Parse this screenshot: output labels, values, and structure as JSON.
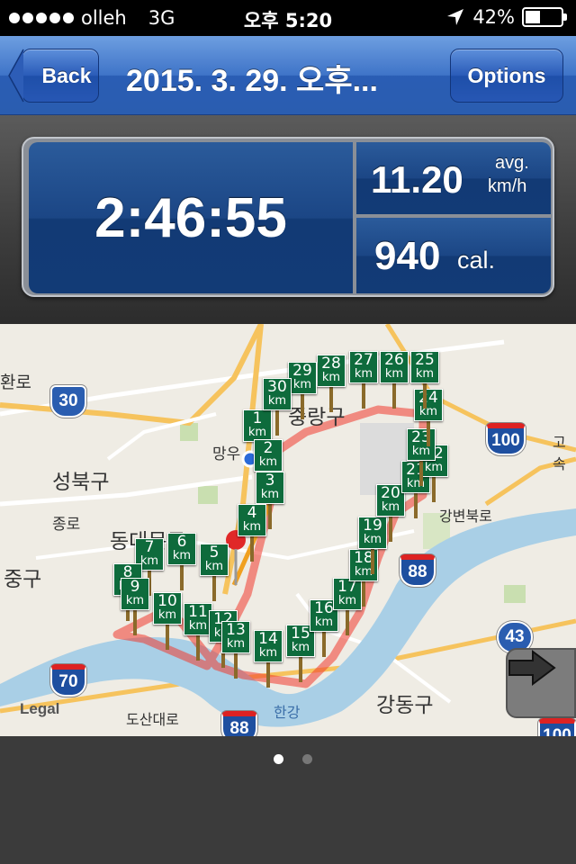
{
  "status_bar": {
    "carrier": "olleh",
    "network": "3G",
    "time": "오후 5:20",
    "battery": "42%",
    "battery_level": 0.42
  },
  "nav": {
    "back_label": "Back",
    "title": "2015. 3. 29. 오후...",
    "options_label": "Options"
  },
  "stats": {
    "duration": "2:46:55",
    "speed_value": "11.20",
    "speed_unit_line1": "avg.",
    "speed_unit_line2": "km/h",
    "calories_value": "940",
    "calories_unit": "cal."
  },
  "map": {
    "legal": "Legal",
    "labels": [
      "환로",
      "성북구",
      "종로",
      "동대문구",
      "중구",
      "망우",
      "중랑구",
      "강변북로",
      "강동구",
      "도산대로",
      "한강",
      "고속"
    ],
    "road_shields": [
      "30",
      "100",
      "88",
      "43",
      "70",
      "88",
      "100"
    ],
    "markers": [
      {
        "n": "1",
        "u": "km"
      },
      {
        "n": "2",
        "u": "km"
      },
      {
        "n": "3",
        "u": "km"
      },
      {
        "n": "4",
        "u": "km"
      },
      {
        "n": "5",
        "u": "km"
      },
      {
        "n": "6",
        "u": "km"
      },
      {
        "n": "7",
        "u": "km"
      },
      {
        "n": "8",
        "u": "km"
      },
      {
        "n": "9",
        "u": "km"
      },
      {
        "n": "10",
        "u": "km"
      },
      {
        "n": "11",
        "u": "km"
      },
      {
        "n": "12",
        "u": "km"
      },
      {
        "n": "13",
        "u": "km"
      },
      {
        "n": "14",
        "u": "km"
      },
      {
        "n": "15",
        "u": "km"
      },
      {
        "n": "16",
        "u": "km"
      },
      {
        "n": "17",
        "u": "km"
      },
      {
        "n": "18",
        "u": "km"
      },
      {
        "n": "19",
        "u": "km"
      },
      {
        "n": "20",
        "u": "km"
      },
      {
        "n": "21",
        "u": "km"
      },
      {
        "n": "22",
        "u": "km"
      },
      {
        "n": "23",
        "u": "km"
      },
      {
        "n": "24",
        "u": "km"
      },
      {
        "n": "25",
        "u": "km"
      },
      {
        "n": "26",
        "u": "km"
      },
      {
        "n": "27",
        "u": "km"
      },
      {
        "n": "28",
        "u": "km"
      },
      {
        "n": "29",
        "u": "km"
      },
      {
        "n": "30",
        "u": "km"
      }
    ]
  },
  "pager": {
    "pages": 2,
    "current": 1
  }
}
